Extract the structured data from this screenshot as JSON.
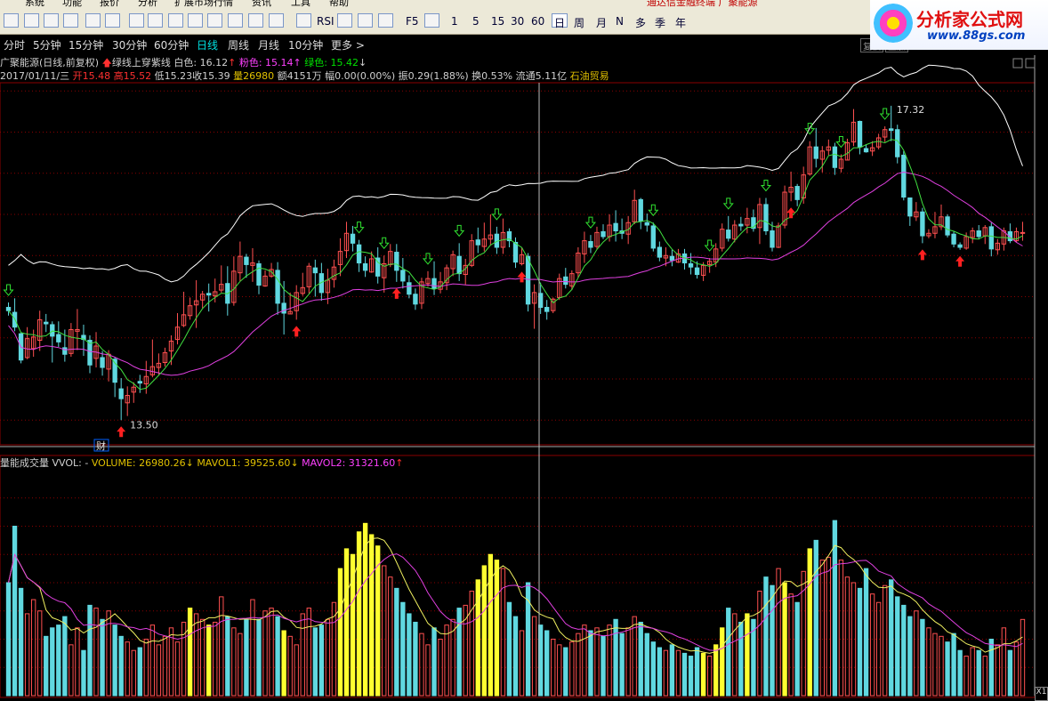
{
  "menu": {
    "items": [
      "系统",
      "功能",
      "报价",
      "分析",
      "扩展市场行情",
      "资讯",
      "工具",
      "帮助"
    ],
    "title": "通达信金融终端  广聚能源"
  },
  "toolbar": {
    "periods": [
      "1",
      "5",
      "15",
      "30",
      "60",
      "日",
      "周",
      "月",
      "N",
      "多",
      "季",
      "年"
    ],
    "rsi": "RSI",
    "f5": "F5"
  },
  "periodbar": {
    "items": [
      "分时",
      "5分钟",
      "15分钟",
      "30分钟",
      "60分钟",
      "日线",
      "周线",
      "月线",
      "10分钟",
      "更多 >"
    ],
    "active_index": 5,
    "right_buttons": [
      "复权",
      "叠加"
    ]
  },
  "logo": {
    "name": "分析家公式网",
    "url": "www.88gs.com"
  },
  "stock": {
    "title": "广聚能源(日线,前复权)",
    "formula": "绿线上穿紫线",
    "white_label": "白色: 16.12",
    "pink_label": "粉色: 15.14",
    "green_label": "绿色: 15.42",
    "date": "2017/01/11/三",
    "open": "开15.48",
    "high": "高15.52",
    "low": "低15.23",
    "close": "收15.39",
    "vol": "量26980",
    "amount": "额4151万",
    "change": "幅0.00(0.00%)",
    "amplitude": "振0.29(1.88%)",
    "turnover": "换0.53%",
    "float": "流通5.11亿",
    "sector": "石油贸易",
    "max_label": "17.32",
    "min_label": "13.50",
    "cai": "财"
  },
  "volume": {
    "title": "量能成交量",
    "vvol": "VVOL: -",
    "volume": "VOLUME: 26980.26",
    "mavol1": "MAVOL1: 39525.60",
    "mavol2": "MAVOL2: 31321.60"
  },
  "scroll": {
    "label": "X1"
  },
  "colors": {
    "up": "#ff5050",
    "down": "#60d8e0",
    "yellow": "#ffff30",
    "ma_green": "#40e040",
    "ma_purple": "#e040e0",
    "white": "#ffffff",
    "grid": "#8a0000"
  },
  "chart_data": {
    "type": "candlestick",
    "price_range": [
      13.2,
      17.6
    ],
    "volume_range": [
      0,
      80000
    ],
    "candles": [
      [
        14.87,
        14.93,
        14.77,
        14.83,
        40000,
        0
      ],
      [
        14.81,
        14.98,
        14.58,
        14.63,
        60000,
        0
      ],
      [
        14.55,
        14.56,
        14.19,
        14.23,
        38000,
        0
      ],
      [
        14.26,
        14.63,
        14.24,
        14.49,
        29000,
        0
      ],
      [
        14.37,
        14.6,
        14.27,
        14.51,
        34000,
        0
      ],
      [
        14.47,
        14.83,
        14.34,
        14.72,
        30000,
        0
      ],
      [
        14.69,
        14.79,
        14.57,
        14.67,
        21000,
        0
      ],
      [
        14.66,
        14.7,
        14.2,
        14.52,
        24000,
        0
      ],
      [
        14.54,
        14.7,
        14.39,
        14.45,
        25000,
        0
      ],
      [
        14.38,
        14.6,
        14.21,
        14.3,
        28000,
        0
      ],
      [
        14.31,
        14.68,
        14.27,
        14.6,
        18000,
        0
      ],
      [
        14.58,
        14.85,
        14.35,
        14.6,
        24000,
        0
      ],
      [
        14.53,
        14.66,
        14.28,
        14.48,
        16000,
        0
      ],
      [
        14.47,
        14.53,
        14.07,
        14.17,
        32000,
        0
      ],
      [
        14.25,
        14.57,
        14.14,
        14.4,
        31000,
        0
      ],
      [
        14.26,
        14.34,
        14.04,
        14.14,
        27000,
        0
      ],
      [
        14.12,
        14.35,
        13.97,
        14.3,
        30000,
        0
      ],
      [
        14.24,
        14.26,
        13.78,
        13.96,
        25000,
        0
      ],
      [
        13.88,
        14.01,
        13.5,
        13.76,
        21000,
        0
      ],
      [
        13.71,
        13.91,
        13.55,
        13.8,
        19000,
        0
      ],
      [
        13.84,
        13.96,
        13.71,
        13.9,
        16000,
        0
      ],
      [
        13.97,
        14.05,
        13.83,
        13.95,
        17000,
        0
      ],
      [
        13.94,
        14.22,
        13.82,
        14.03,
        20000,
        0
      ],
      [
        14.05,
        14.48,
        14.02,
        14.15,
        25000,
        0
      ],
      [
        14.14,
        14.31,
        14.05,
        14.19,
        18000,
        0
      ],
      [
        14.2,
        14.38,
        14.15,
        14.32,
        21000,
        0
      ],
      [
        14.34,
        14.53,
        14.17,
        14.46,
        24000,
        0
      ],
      [
        14.48,
        14.8,
        14.42,
        14.63,
        19000,
        0
      ],
      [
        14.65,
        15.06,
        14.63,
        14.78,
        26000,
        0
      ],
      [
        14.77,
        14.99,
        14.72,
        14.89,
        31000,
        1
      ],
      [
        14.9,
        15.2,
        14.62,
        14.95,
        29000,
        0
      ],
      [
        14.96,
        15.07,
        14.86,
        15.03,
        27000,
        0
      ],
      [
        15.04,
        15.16,
        14.82,
        15.02,
        25000,
        1
      ],
      [
        15.01,
        15.22,
        14.93,
        15.06,
        26000,
        0
      ],
      [
        15.08,
        15.38,
        15.05,
        15.15,
        35000,
        0
      ],
      [
        15.16,
        15.37,
        14.77,
        14.92,
        28000,
        0
      ],
      [
        14.93,
        15.49,
        14.89,
        15.31,
        24000,
        0
      ],
      [
        15.29,
        15.67,
        15.19,
        15.49,
        22000,
        0
      ],
      [
        15.48,
        15.52,
        15.23,
        15.39,
        26980,
        0
      ],
      [
        15.38,
        15.59,
        15.18,
        15.41,
        34000,
        0
      ],
      [
        15.4,
        15.44,
        15.03,
        15.14,
        27000,
        0
      ],
      [
        15.13,
        15.32,
        15.12,
        15.25,
        30000,
        0
      ],
      [
        15.25,
        15.41,
        15.23,
        15.33,
        31000,
        0
      ],
      [
        15.32,
        15.42,
        14.78,
        14.92,
        28000,
        0
      ],
      [
        14.92,
        15.19,
        14.54,
        14.8,
        23000,
        1
      ],
      [
        14.79,
        15.05,
        14.79,
        14.82,
        21000,
        0
      ],
      [
        14.83,
        15.14,
        14.72,
        15.05,
        18000,
        0
      ],
      [
        15.04,
        15.29,
        15.01,
        15.11,
        29000,
        0
      ],
      [
        15.12,
        15.41,
        15.04,
        15.37,
        31000,
        0
      ],
      [
        15.35,
        15.45,
        15.0,
        15.29,
        24000,
        0
      ],
      [
        15.28,
        15.41,
        14.95,
        15.05,
        25000,
        0
      ],
      [
        15.05,
        15.34,
        14.91,
        15.2,
        27000,
        0
      ],
      [
        15.21,
        15.45,
        15.11,
        15.36,
        33000,
        0
      ],
      [
        15.39,
        15.71,
        15.25,
        15.55,
        45000,
        1
      ],
      [
        15.56,
        15.91,
        15.47,
        15.77,
        52000,
        1
      ],
      [
        15.76,
        15.86,
        15.55,
        15.65,
        50000,
        1
      ],
      [
        15.63,
        15.69,
        15.3,
        15.41,
        58000,
        1
      ],
      [
        15.4,
        15.49,
        15.24,
        15.32,
        61000,
        1
      ],
      [
        15.3,
        15.55,
        15.29,
        15.46,
        57000,
        1
      ],
      [
        15.47,
        15.6,
        15.16,
        15.25,
        53000,
        1
      ],
      [
        15.23,
        15.5,
        15.05,
        15.4,
        46000,
        0
      ],
      [
        15.39,
        15.64,
        15.36,
        15.55,
        42000,
        0
      ],
      [
        15.54,
        15.64,
        15.18,
        15.32,
        38000,
        0
      ],
      [
        15.32,
        15.47,
        15.1,
        15.19,
        33000,
        0
      ],
      [
        15.17,
        15.26,
        14.98,
        15.03,
        29000,
        0
      ],
      [
        15.03,
        15.1,
        14.84,
        14.91,
        26000,
        0
      ],
      [
        14.92,
        15.23,
        14.85,
        15.18,
        22000,
        0
      ],
      [
        15.16,
        15.31,
        15.12,
        15.22,
        18000,
        0
      ],
      [
        15.22,
        15.43,
        15.02,
        15.1,
        24000,
        0
      ],
      [
        15.09,
        15.3,
        15.04,
        15.18,
        20000,
        0
      ],
      [
        15.17,
        15.39,
        15.08,
        15.35,
        25000,
        0
      ],
      [
        15.34,
        15.56,
        15.25,
        15.51,
        27000,
        0
      ],
      [
        15.49,
        15.65,
        15.19,
        15.28,
        31000,
        0
      ],
      [
        15.27,
        15.46,
        15.14,
        15.38,
        32000,
        0
      ],
      [
        15.38,
        15.76,
        15.36,
        15.68,
        37000,
        0
      ],
      [
        15.69,
        15.84,
        15.53,
        15.63,
        41000,
        1
      ],
      [
        15.61,
        15.9,
        15.55,
        15.7,
        46000,
        1
      ],
      [
        15.7,
        16.0,
        15.62,
        15.75,
        50000,
        1
      ],
      [
        15.76,
        15.85,
        15.52,
        15.6,
        48000,
        1
      ],
      [
        15.6,
        15.95,
        15.52,
        15.78,
        45000,
        0
      ],
      [
        15.79,
        15.83,
        15.6,
        15.68,
        33000,
        0
      ],
      [
        15.66,
        15.72,
        15.35,
        15.42,
        28000,
        0
      ],
      [
        15.4,
        15.6,
        15.38,
        15.51,
        23000,
        0
      ],
      [
        15.49,
        15.53,
        14.82,
        14.91,
        40000,
        0
      ],
      [
        14.92,
        15.15,
        14.61,
        15.05,
        28000,
        0
      ],
      [
        15.04,
        15.17,
        14.79,
        14.87,
        25000,
        0
      ],
      [
        14.87,
        14.96,
        14.72,
        14.82,
        23000,
        0
      ],
      [
        14.83,
        14.99,
        14.8,
        14.97,
        20000,
        0
      ],
      [
        14.99,
        15.28,
        14.96,
        15.22,
        18000,
        0
      ],
      [
        15.24,
        15.35,
        15.1,
        15.15,
        17000,
        0
      ],
      [
        15.13,
        15.32,
        15.08,
        15.28,
        19000,
        0
      ],
      [
        15.29,
        15.6,
        15.23,
        15.53,
        22000,
        0
      ],
      [
        15.52,
        15.79,
        15.41,
        15.68,
        25000,
        0
      ],
      [
        15.67,
        15.75,
        15.53,
        15.6,
        23000,
        0
      ],
      [
        15.61,
        15.85,
        15.58,
        15.78,
        24000,
        0
      ],
      [
        15.79,
        15.88,
        15.7,
        15.73,
        21000,
        0
      ],
      [
        15.73,
        16.0,
        15.67,
        15.87,
        25000,
        0
      ],
      [
        15.89,
        16.05,
        15.67,
        15.8,
        27000,
        0
      ],
      [
        15.8,
        15.95,
        15.7,
        15.77,
        22000,
        0
      ],
      [
        15.76,
        15.98,
        15.64,
        15.9,
        24000,
        0
      ],
      [
        15.91,
        16.3,
        15.88,
        16.17,
        28000,
        0
      ],
      [
        16.18,
        16.2,
        15.82,
        15.92,
        26000,
        0
      ],
      [
        15.9,
        16.01,
        15.79,
        15.87,
        22000,
        0
      ],
      [
        15.86,
        15.9,
        15.55,
        15.59,
        19000,
        0
      ],
      [
        15.6,
        15.67,
        15.43,
        15.48,
        17000,
        0
      ],
      [
        15.47,
        15.6,
        15.37,
        15.5,
        16000,
        0
      ],
      [
        15.49,
        15.57,
        15.37,
        15.44,
        18000,
        0
      ],
      [
        15.42,
        15.58,
        15.41,
        15.52,
        16000,
        0
      ],
      [
        15.52,
        15.58,
        15.33,
        15.41,
        15000,
        0
      ],
      [
        15.4,
        15.53,
        15.27,
        15.36,
        14000,
        0
      ],
      [
        15.35,
        15.43,
        15.22,
        15.27,
        17000,
        0
      ],
      [
        15.26,
        15.42,
        15.19,
        15.38,
        15000,
        1
      ],
      [
        15.39,
        15.47,
        15.29,
        15.43,
        14000,
        0
      ],
      [
        15.42,
        15.65,
        15.36,
        15.58,
        18000,
        1
      ],
      [
        15.59,
        15.89,
        15.55,
        15.82,
        24000,
        1
      ],
      [
        15.81,
        15.98,
        15.67,
        15.71,
        31000,
        0
      ],
      [
        15.7,
        15.93,
        15.66,
        15.87,
        29000,
        0
      ],
      [
        15.88,
        15.97,
        15.8,
        15.86,
        26000,
        0
      ],
      [
        15.87,
        16.08,
        15.77,
        15.95,
        29000,
        1
      ],
      [
        15.96,
        16.06,
        15.79,
        15.83,
        27000,
        0
      ],
      [
        15.84,
        16.2,
        15.64,
        16.12,
        37000,
        0
      ],
      [
        16.12,
        16.2,
        15.75,
        15.8,
        42000,
        0
      ],
      [
        15.8,
        15.91,
        15.55,
        15.6,
        39000,
        0
      ],
      [
        15.6,
        15.9,
        15.59,
        15.86,
        45000,
        0
      ],
      [
        15.87,
        16.35,
        15.83,
        16.27,
        40000,
        1
      ],
      [
        16.27,
        16.52,
        16.16,
        16.33,
        36000,
        0
      ],
      [
        16.34,
        16.37,
        16.1,
        16.18,
        33000,
        0
      ],
      [
        16.2,
        16.58,
        16.13,
        16.48,
        44000,
        0
      ],
      [
        16.49,
        16.89,
        16.47,
        16.82,
        52000,
        1
      ],
      [
        16.82,
        17.05,
        16.57,
        16.68,
        55000,
        0
      ],
      [
        16.67,
        16.83,
        16.51,
        16.77,
        48000,
        0
      ],
      [
        16.78,
        16.91,
        16.72,
        16.82,
        49000,
        0
      ],
      [
        16.82,
        16.87,
        16.48,
        16.57,
        62000,
        0
      ],
      [
        16.56,
        16.73,
        16.51,
        16.67,
        48000,
        0
      ],
      [
        16.66,
        16.92,
        16.66,
        16.87,
        42000,
        0
      ],
      [
        16.88,
        17.28,
        16.83,
        17.12,
        40000,
        0
      ],
      [
        17.13,
        17.14,
        16.73,
        16.82,
        38000,
        0
      ],
      [
        16.8,
        16.85,
        16.75,
        16.76,
        45000,
        0
      ],
      [
        16.77,
        16.89,
        16.71,
        16.81,
        36000,
        0
      ],
      [
        16.82,
        16.98,
        16.79,
        16.93,
        33000,
        0
      ],
      [
        16.94,
        17.07,
        16.88,
        17.03,
        39000,
        0
      ],
      [
        17.04,
        17.32,
        16.89,
        17.02,
        41000,
        0
      ],
      [
        17.03,
        17.09,
        16.62,
        16.7,
        35000,
        0
      ],
      [
        16.72,
        16.77,
        16.17,
        16.21,
        32000,
        0
      ],
      [
        16.2,
        16.2,
        15.86,
        15.98,
        28000,
        0
      ],
      [
        15.97,
        16.15,
        15.92,
        16.03,
        30000,
        0
      ],
      [
        16.03,
        16.08,
        15.65,
        15.74,
        27000,
        0
      ],
      [
        15.74,
        15.82,
        15.71,
        15.77,
        24000,
        0
      ],
      [
        15.77,
        16.03,
        15.71,
        15.85,
        22000,
        0
      ],
      [
        15.85,
        16.12,
        15.81,
        15.97,
        21000,
        0
      ],
      [
        15.97,
        16.0,
        15.72,
        15.75,
        19000,
        0
      ],
      [
        15.76,
        15.79,
        15.6,
        15.64,
        22000,
        0
      ],
      [
        15.63,
        15.66,
        15.57,
        15.6,
        16000,
        0
      ],
      [
        15.59,
        15.78,
        15.57,
        15.73,
        14000,
        0
      ],
      [
        15.72,
        15.84,
        15.65,
        15.8,
        17000,
        0
      ],
      [
        15.8,
        15.87,
        15.7,
        15.73,
        16000,
        0
      ],
      [
        15.74,
        15.87,
        15.64,
        15.84,
        14000,
        0
      ],
      [
        15.85,
        15.9,
        15.49,
        15.58,
        20000,
        0
      ],
      [
        15.57,
        15.7,
        15.51,
        15.65,
        18000,
        0
      ],
      [
        15.64,
        15.84,
        15.56,
        15.8,
        24000,
        0
      ],
      [
        15.79,
        15.89,
        15.65,
        15.68,
        16000,
        0
      ],
      [
        15.68,
        15.84,
        15.66,
        15.79,
        19000,
        0
      ],
      [
        15.78,
        15.91,
        15.68,
        15.78,
        26980,
        0
      ]
    ],
    "signals_up": [
      18,
      46,
      62,
      82,
      125,
      146,
      152
    ],
    "signals_down": [
      0,
      56,
      60,
      67,
      72,
      78,
      93,
      103,
      112,
      115,
      121,
      128,
      133,
      140
    ]
  }
}
